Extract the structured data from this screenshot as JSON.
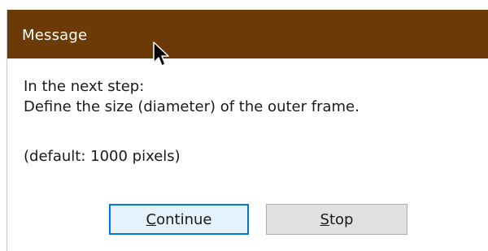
{
  "dialog": {
    "title": "Message",
    "lines": [
      "In the next step:",
      "Define the size (diameter) of the outer frame.",
      "(default: 1000 pixels)"
    ],
    "buttons": {
      "continue": {
        "mnemonic": "C",
        "rest": "ontinue"
      },
      "stop": {
        "mnemonic": "S",
        "rest": "top"
      }
    }
  },
  "colors": {
    "titlebar": "#6b3a06",
    "title_text": "#ffffff",
    "focused_button_border": "#0078d7",
    "focused_button_bg": "#e5f1fb",
    "button_bg": "#e1e1e1"
  },
  "icons": {
    "cursor": "mouse-pointer-icon"
  }
}
